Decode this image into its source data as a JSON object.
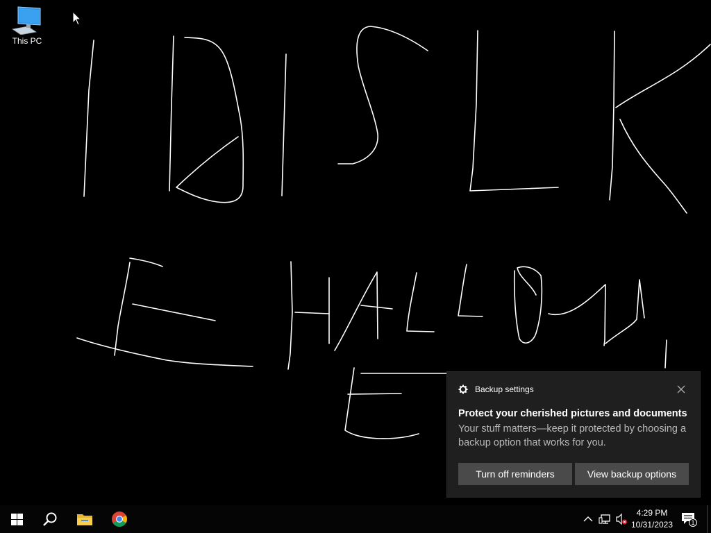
{
  "desktop": {
    "icons": [
      {
        "label": "This PC",
        "icon": "this-pc-icon"
      }
    ],
    "background_color": "#000000",
    "scribble_color": "#ffffff"
  },
  "notification": {
    "app_name": "Backup settings",
    "title": "Protect your cherished pictures and documents",
    "body": "Your stuff matters—keep it protected by choosing a backup option that works for you.",
    "buttons": {
      "turn_off": "Turn off reminders",
      "view": "View backup options"
    },
    "background": "#1f1f1f",
    "button_color": "#4a4a4a"
  },
  "taskbar": {
    "pinned": [
      "windows-start-icon",
      "search-icon",
      "file-explorer-icon",
      "chrome-icon"
    ],
    "tray_icons": [
      "chevron-up-icon",
      "network-icon",
      "volume-muted-icon"
    ],
    "clock": {
      "time": "4:29 PM",
      "date": "10/31/2023"
    },
    "notification_count": "1"
  }
}
